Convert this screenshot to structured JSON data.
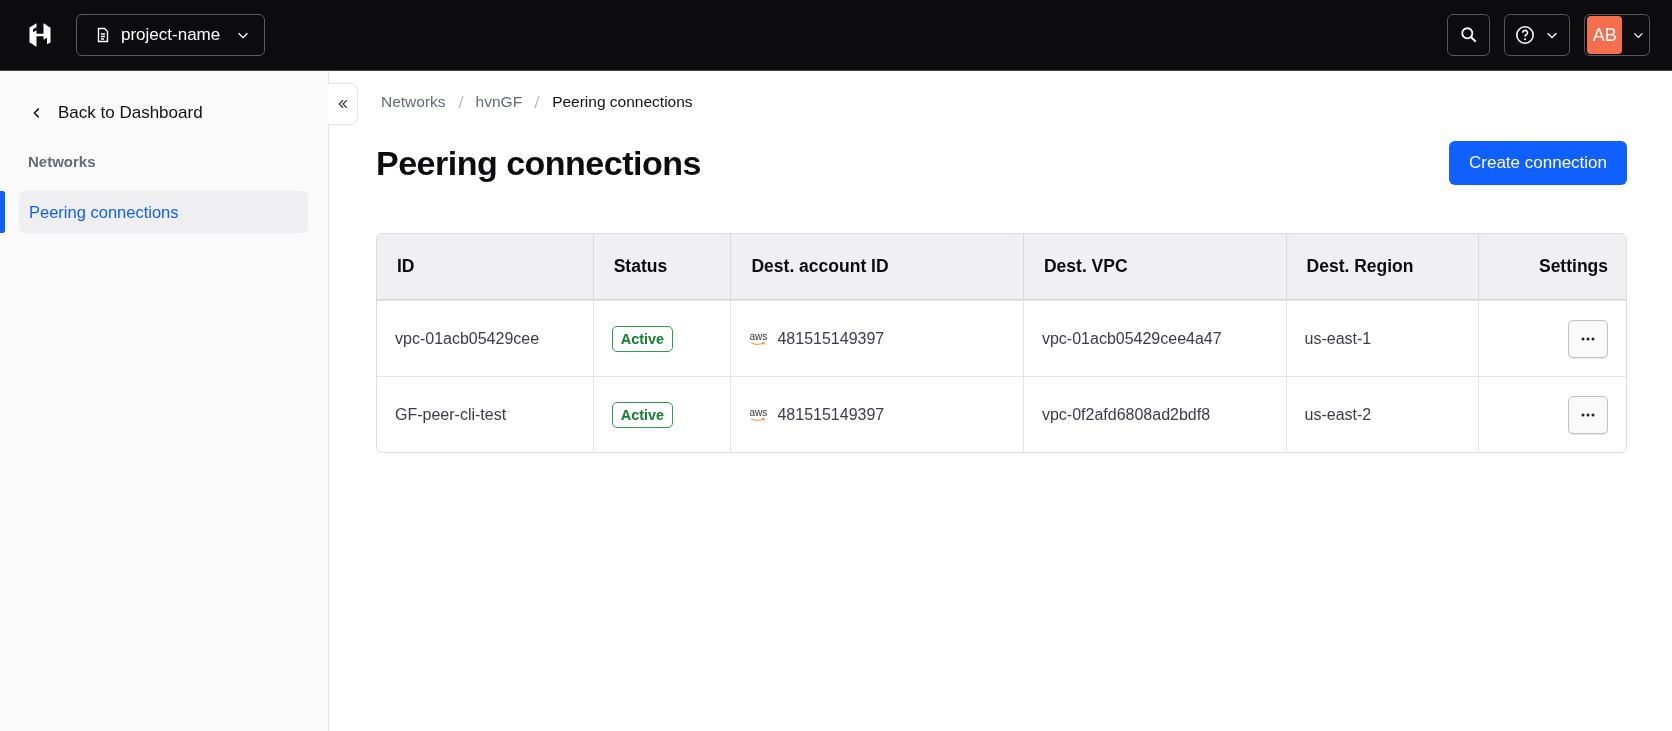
{
  "top_bar": {
    "project": "project-name",
    "avatar": "AB"
  },
  "sidebar": {
    "back_link": "Back to Dashboard",
    "section": "Networks",
    "items": [
      {
        "label": "Peering connections",
        "selected": true
      }
    ]
  },
  "breadcrumbs": [
    "Networks",
    "hvnGF",
    "Peering connections"
  ],
  "page_title": "Peering connections",
  "primary_action": "Create connection",
  "table": {
    "columns": [
      "ID",
      "Status",
      "Dest. account ID",
      "Dest. VPC",
      "Dest. Region",
      "Settings"
    ],
    "rows": [
      {
        "id": "vpc-01acb05429cee",
        "status": "Active",
        "provider": "aws",
        "account": "481515149397",
        "vpc": "vpc-01acb05429cee4a47",
        "region": "us-east-1"
      },
      {
        "id": "GF-peer-cli-test",
        "status": "Active",
        "provider": "aws",
        "account": "481515149397",
        "vpc": "vpc-0f2afd6808ad2bdf8",
        "region": "us-east-2"
      }
    ]
  }
}
